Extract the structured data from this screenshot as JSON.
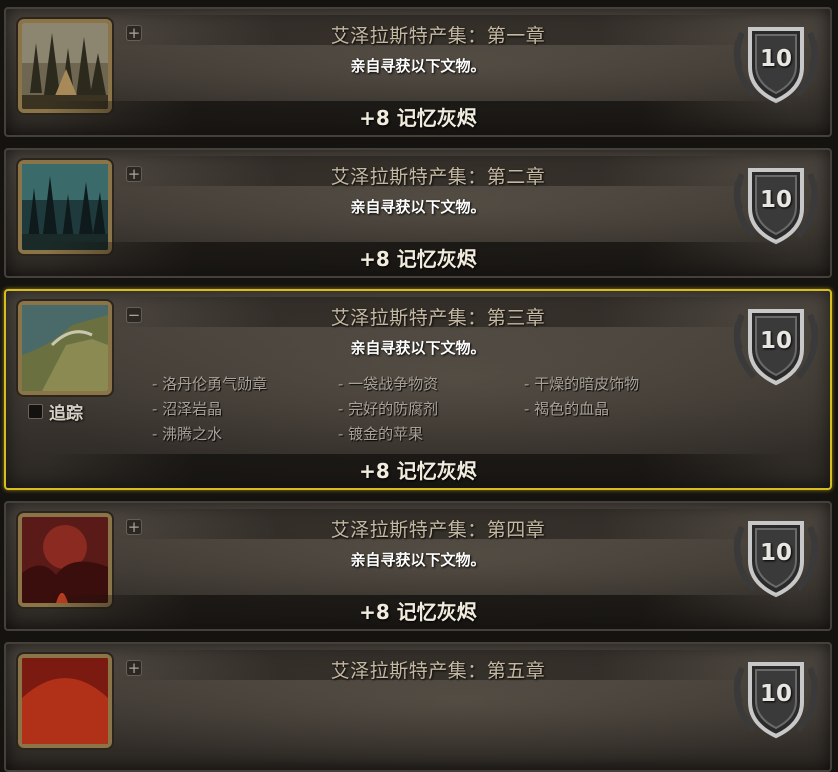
{
  "achievements": [
    {
      "title": "艾泽拉斯特产集：第一章",
      "description": "亲自寻获以下文物。",
      "reward": "+8 记忆灰烬",
      "points": "10",
      "toggle": "+",
      "art": "forest"
    },
    {
      "title": "艾泽拉斯特产集：第二章",
      "description": "亲自寻获以下文物。",
      "reward": "+8 记忆灰烬",
      "points": "10",
      "toggle": "+",
      "art": "darkforest"
    },
    {
      "title": "艾泽拉斯特产集：第三章",
      "description": "亲自寻获以下文物。",
      "reward": "+8 记忆灰烬",
      "points": "10",
      "toggle": "−",
      "art": "cliff",
      "track_label": "追踪",
      "criteria": [
        "- 洛丹伦勇气勋章",
        "- 一袋战争物资",
        "- 干燥的暗皮饰物",
        "- 沼泽岩晶",
        "- 完好的防腐剂",
        "- 褐色的血晶",
        "- 沸腾之水",
        "- 镀金的苹果"
      ]
    },
    {
      "title": "艾泽拉斯特产集：第四章",
      "description": "亲自寻获以下文物。",
      "reward": "+8 记忆灰烬",
      "points": "10",
      "toggle": "+",
      "art": "volcano"
    },
    {
      "title": "艾泽拉斯特产集：第五章",
      "points": "10",
      "toggle": "+",
      "art": "fire"
    }
  ],
  "colors": {
    "expanded_border": "#d8bd1e",
    "criteria_text": "#a9a197",
    "title_text": "#c4b8a2"
  }
}
